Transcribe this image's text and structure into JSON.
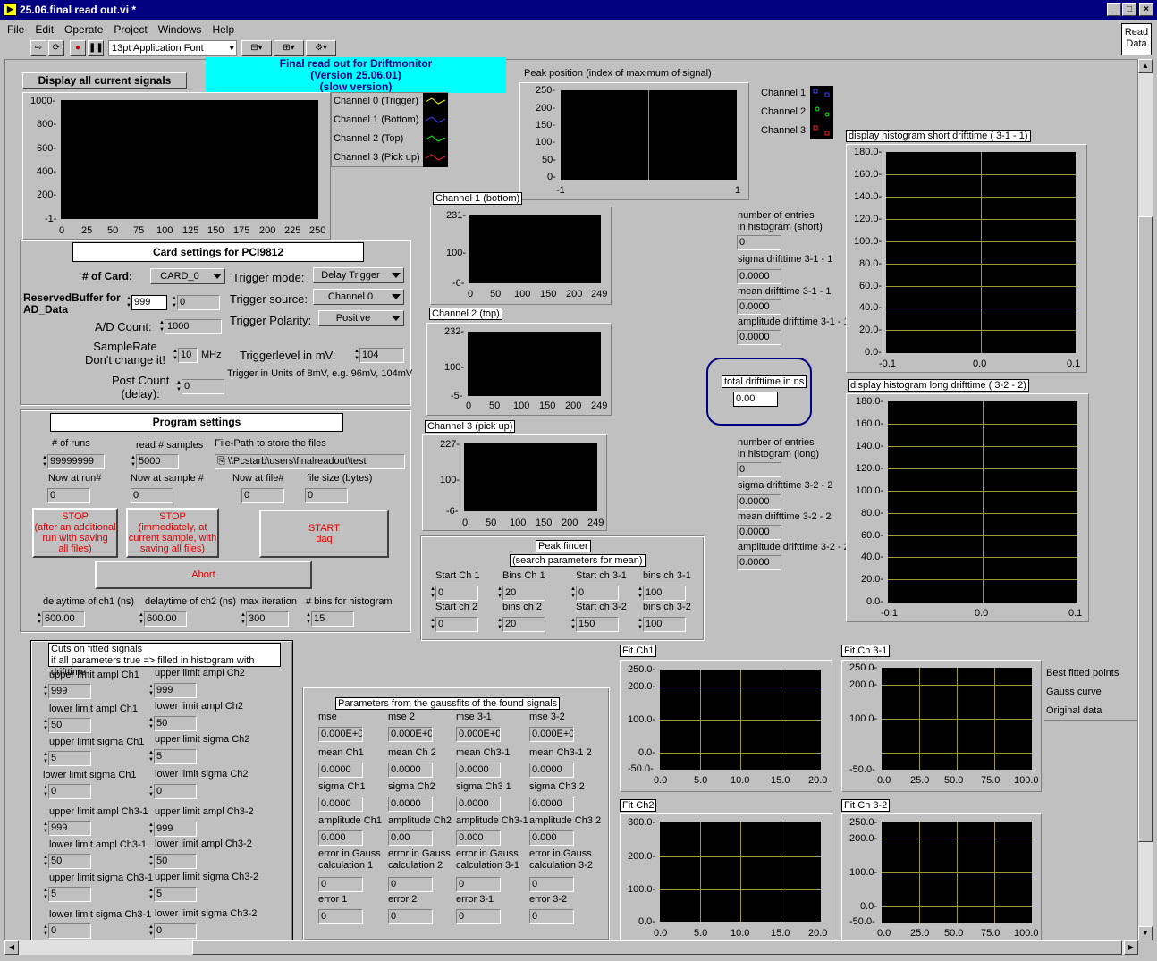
{
  "window": {
    "title": "25.06.final read out.vi *"
  },
  "menu": [
    "File",
    "Edit",
    "Operate",
    "Project",
    "Windows",
    "Help"
  ],
  "toolbar": {
    "font": "13pt Application Font",
    "read_data": "Read Data"
  },
  "header": {
    "display_all": "Display all current signals",
    "banner": [
      "Final read out for Driftmonitor",
      "(Version 25.06.01)",
      "(slow version)"
    ]
  },
  "main_graph": {
    "legend": [
      "Channel 0 (Trigger)",
      "Channel 1 (Bottom)",
      "Channel 2 (Top)",
      "Channel 3 (Pick up)"
    ],
    "legend_colors": [
      "#ffff00",
      "#4040ff",
      "#00ff00",
      "#ff2020"
    ],
    "yticks": [
      "1000-",
      "800-",
      "600-",
      "400-",
      "200-",
      "-1-"
    ],
    "xticks": [
      "0",
      "25",
      "50",
      "75",
      "100",
      "125",
      "150",
      "175",
      "200",
      "225",
      "250"
    ]
  },
  "card": {
    "title": "Card settings for PCI9812",
    "num_card_label": "# of Card:",
    "num_card": "CARD_0",
    "reserved_label": "ReservedBuffer for AD_Data",
    "reserved_a": "999",
    "reserved_b": "0",
    "ad_label": "A/D Count:",
    "ad_value": "1000",
    "sr_label1": "SampleRate",
    "sr_label2": "Don't change it!",
    "sr_value": "10",
    "sr_unit": "MHz",
    "pc_label1": "Post Count",
    "pc_label2": "(delay):",
    "pc_value": "0",
    "trig_mode_label": "Trigger mode:",
    "trig_mode": "Delay Trigger",
    "trig_src_label": "Trigger source:",
    "trig_src": "Channel 0",
    "trig_pol_label": "Trigger Polarity:",
    "trig_pol": "Positive",
    "trig_level_label": "Triggerlevel in mV:",
    "trig_level": "104",
    "trig_note": "Trigger in Units of 8mV, e.g. 96mV, 104mV"
  },
  "program": {
    "title": "Program settings",
    "runs_label": "# of runs",
    "runs": "99999999",
    "read_label": "read # samples",
    "read": "5000",
    "path_label": "File-Path to store the files",
    "path": "\\\\Pcstarb\\users\\finalreadout\\test",
    "now_run_label": "Now at run#",
    "now_run": "0",
    "now_sample_label": "Now at sample #",
    "now_sample": "0",
    "now_file_label": "Now at file#",
    "now_file": "0",
    "file_size_label": "file size (bytes)",
    "file_size": "0",
    "stop1": [
      "STOP",
      "(after an additional",
      "run with saving",
      "all files)"
    ],
    "stop2": [
      "STOP",
      "(immediately, at",
      "current sample, with",
      "saving all files)"
    ],
    "start": [
      "START",
      "daq"
    ],
    "abort": "Abort",
    "delay1_label": "delaytime of ch1 (ns)",
    "delay1": "600.00",
    "delay2_label": "delaytime of ch2 (ns)",
    "delay2": "600.00",
    "maxit_label": "max iteration",
    "maxit": "300",
    "bins_label": "# bins for histogram",
    "bins": "15"
  },
  "peak_pos": {
    "title": "Peak position (index of maximum of signal)",
    "yticks": [
      "250-",
      "200-",
      "150-",
      "100-",
      "50-",
      "0-"
    ],
    "xticks": [
      "-1",
      "1"
    ],
    "legend": [
      "Channel 1",
      "Channel 2",
      "Channel 3"
    ]
  },
  "ch1": {
    "title": "Channel 1 (bottom)",
    "yticks": [
      "231-",
      "100-",
      "-6-"
    ],
    "xticks": [
      "0",
      "50",
      "100",
      "150",
      "200",
      "249"
    ]
  },
  "ch2": {
    "title": "Channel 2 (top)",
    "yticks": [
      "232-",
      "100-",
      "-5-"
    ],
    "xticks": [
      "0",
      "50",
      "100",
      "150",
      "200",
      "249"
    ]
  },
  "ch3": {
    "title": "Channel 3 (pick up)",
    "yticks": [
      "227-",
      "100-",
      "-6-"
    ],
    "xticks": [
      "0",
      "50",
      "100",
      "150",
      "200",
      "249"
    ]
  },
  "short_stats": {
    "entries_label1": "number of entries",
    "entries_label2": "in histogram (short)",
    "entries": "0",
    "sigma_label": "sigma drifttime 3-1 - 1",
    "sigma": "0.0000",
    "mean_label": "mean drifttime 3-1 - 1",
    "mean": "0.0000",
    "amp_label": "amplitude drifttime 3-1 - 1",
    "amp": "0.0000"
  },
  "long_stats": {
    "entries_label1": "number of entries",
    "entries_label2": "in histogram (long)",
    "entries": "0",
    "sigma_label": "sigma drifttime 3-2 - 2",
    "sigma": "0.0000",
    "mean_label": "mean drifttime 3-2 - 2",
    "mean": "0.0000",
    "amp_label": "amplitude drifttime 3-2 - 2",
    "amp": "0.0000"
  },
  "total": {
    "label": "total drifttime in ns",
    "value": "0.00"
  },
  "hist_short": {
    "title": "display histogram short drifttime ( 3-1 - 1)",
    "yticks": [
      "180.0-",
      "160.0-",
      "140.0-",
      "120.0-",
      "100.0-",
      "80.0-",
      "60.0-",
      "40.0-",
      "20.0-",
      "0.0-"
    ],
    "xticks": [
      "-0.1",
      "0.0",
      "0.1"
    ]
  },
  "hist_long": {
    "title": "display histogram long drifttime ( 3-2 - 2)",
    "yticks": [
      "180.0-",
      "160.0-",
      "140.0-",
      "120.0-",
      "100.0-",
      "80.0-",
      "60.0-",
      "40.0-",
      "20.0-",
      "0.0-"
    ],
    "xticks": [
      "-0.1",
      "0.0",
      "0.1"
    ]
  },
  "peak_finder": {
    "title": "Peak finder",
    "subtitle": "(search parameters for mean)",
    "labels": [
      "Start Ch 1",
      "Bins Ch 1",
      "Start ch 3-1",
      "bins ch 3-1",
      "Start ch 2",
      "bins ch 2",
      "Start ch 3-2",
      "bins ch 3-2"
    ],
    "values": [
      "0",
      "20",
      "0",
      "100",
      "0",
      "20",
      "150",
      "100"
    ]
  },
  "cuts": {
    "title1": "Cuts on fitted signals",
    "title2": "if all parameters true => filled in histogram with drifttime",
    "left_labels": [
      "upper limit ampl Ch1",
      "lower limit ampl Ch1",
      "upper limit sigma Ch1",
      "lower limit sigma Ch1",
      "upper limit ampl Ch3-1",
      "lower limit ampl Ch3-1",
      "upper limit sigma Ch3-1",
      "lower limit sigma Ch3-1"
    ],
    "left_values": [
      "999",
      "50",
      "5",
      "0",
      "999",
      "50",
      "5",
      "0"
    ],
    "right_labels": [
      "upper limit ampl Ch2",
      "lower limit ampl Ch2",
      "upper limit sigma Ch2",
      "lower limit sigma Ch2",
      "upper limit ampl Ch3-2",
      "lower limit ampl Ch3-2",
      "upper limit sigma Ch3-2",
      "lower limit sigma Ch3-2"
    ],
    "right_values": [
      "999",
      "50",
      "5",
      "0",
      "999",
      "50",
      "5",
      "0"
    ]
  },
  "params": {
    "title": "Parameters from the gaussfits of the found signals",
    "rows": [
      {
        "labels": [
          "mse",
          "mse 2",
          "mse 3-1",
          "mse 3-2"
        ],
        "values": [
          "0.000E+0",
          "0.000E+0",
          "0.000E+0",
          "0.000E+0"
        ]
      },
      {
        "labels": [
          "mean Ch1",
          "mean Ch 2",
          "mean Ch3-1",
          "mean Ch3-1 2"
        ],
        "values": [
          "0.0000",
          "0.0000",
          "0.0000",
          "0.0000"
        ]
      },
      {
        "labels": [
          "sigma Ch1",
          "sigma Ch2",
          "sigma Ch3 1",
          "sigma Ch3 2"
        ],
        "values": [
          "0.0000",
          "0.0000",
          "0.0000",
          "0.0000"
        ]
      },
      {
        "labels": [
          "amplitude Ch1",
          "amplitude Ch2",
          "amplitude Ch3-1",
          "amplitude Ch3 2"
        ],
        "values": [
          "0.000",
          "0.00",
          "0.000",
          "0.000"
        ]
      },
      {
        "labels": [
          "error in Gauss calculation 1",
          "error in Gauss calculation 2",
          "error in Gauss calculation 3-1",
          "error in Gauss calculation 3-2"
        ],
        "values": [
          "0",
          "0",
          "0",
          "0"
        ]
      },
      {
        "labels": [
          "error 1",
          "error 2",
          "error 3-1",
          "error 3-2"
        ],
        "values": [
          "0",
          "0",
          "0",
          "0"
        ]
      }
    ]
  },
  "fit_ch1": {
    "title": "Fit Ch1",
    "yticks": [
      "250.0-",
      "200.0-",
      "100.0-",
      "0.0-",
      "-50.0-"
    ],
    "xticks": [
      "0.0",
      "5.0",
      "10.0",
      "15.0",
      "20.0"
    ]
  },
  "fit_ch31": {
    "title": "Fit Ch 3-1",
    "yticks": [
      "250.0-",
      "200.0-",
      "100.0-",
      "0.0-",
      "-50.0-"
    ],
    "xticks": [
      "0.0",
      "25.0",
      "50.0",
      "75.0",
      "100.0"
    ]
  },
  "fit_ch2": {
    "title": "Fit Ch2",
    "yticks": [
      "300.0-",
      "200.0-",
      "100.0-",
      "0.0-"
    ],
    "xticks": [
      "0.0",
      "5.0",
      "10.0",
      "15.0",
      "20.0"
    ]
  },
  "fit_ch32": {
    "title": "Fit Ch 3-2",
    "yticks": [
      "250.0-",
      "200.0-",
      "100.0-",
      "0.0-",
      "-50.0-"
    ],
    "xticks": [
      "0.0",
      "25.0",
      "50.0",
      "75.0",
      "100.0"
    ]
  },
  "fit_legend": [
    "Best fitted points",
    "Gauss curve",
    "Original data"
  ]
}
